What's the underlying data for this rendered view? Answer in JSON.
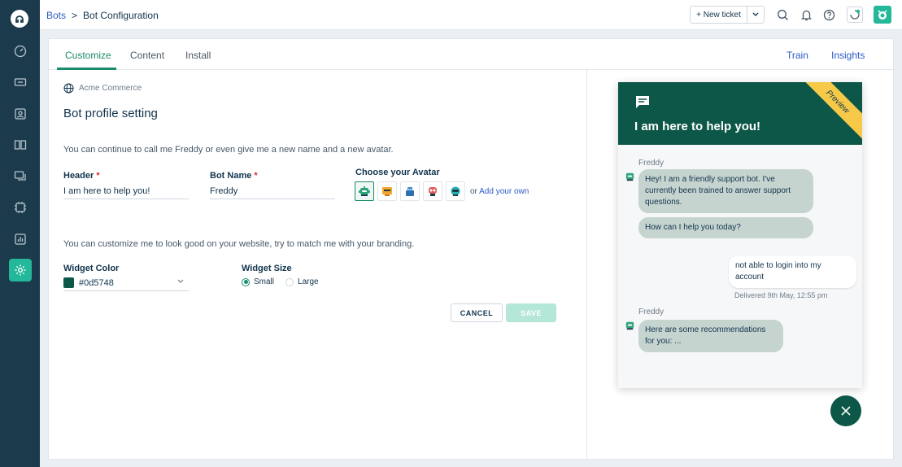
{
  "rail": {
    "items": [
      "dashboard-icon",
      "tickets-icon",
      "contacts-icon",
      "solutions-icon",
      "forums-icon",
      "bot-icon",
      "reports-icon",
      "admin-settings-icon"
    ]
  },
  "topbar": {
    "breadcrumb_root": "Bots",
    "breadcrumb_sep": ">",
    "breadcrumb_current": "Bot Configuration",
    "new_ticket_label": "+ New ticket"
  },
  "tabs": {
    "customize": "Customize",
    "content": "Content",
    "install": "Install",
    "train": "Train",
    "insights": "Insights"
  },
  "profile": {
    "org_name": "Acme Commerce",
    "title": "Bot profile setting",
    "intro": "You can continue to call me Freddy or even give me a new name and a new avatar.",
    "header_label": "Header",
    "header_value": "I am here to help you!",
    "bot_name_label": "Bot Name",
    "bot_name_value": "Freddy",
    "required_mark": "*",
    "avatar_label": "Choose your Avatar",
    "avatar_or": "or",
    "add_own": "Add your own",
    "branding_intro": "You can customize me to look good on your website, try to match me with your branding.",
    "widget_color_label": "Widget Color",
    "widget_color_value": "#0d5748",
    "widget_size_label": "Widget Size",
    "size_small": "Small",
    "size_large": "Large",
    "cancel_label": "CANCEL",
    "save_label": "SAVE"
  },
  "preview": {
    "ribbon": "Preview",
    "title": "I am here to help you!",
    "sender1": "Freddy",
    "msg1": "Hey! I am a friendly support bot. I've currently been trained to answer support questions.",
    "msg2": "How can I help you today?",
    "user_msg": "not able to login into my account",
    "delivered": "Delivered 9th May, 12:55 pm",
    "sender2": "Freddy",
    "msg3": "Here are some recommendations for you: ..."
  },
  "colors": {
    "brand_green": "#0d5748",
    "accent": "#1a8a6d",
    "rail": "#1b3a4b",
    "link": "#2c5cc5"
  }
}
